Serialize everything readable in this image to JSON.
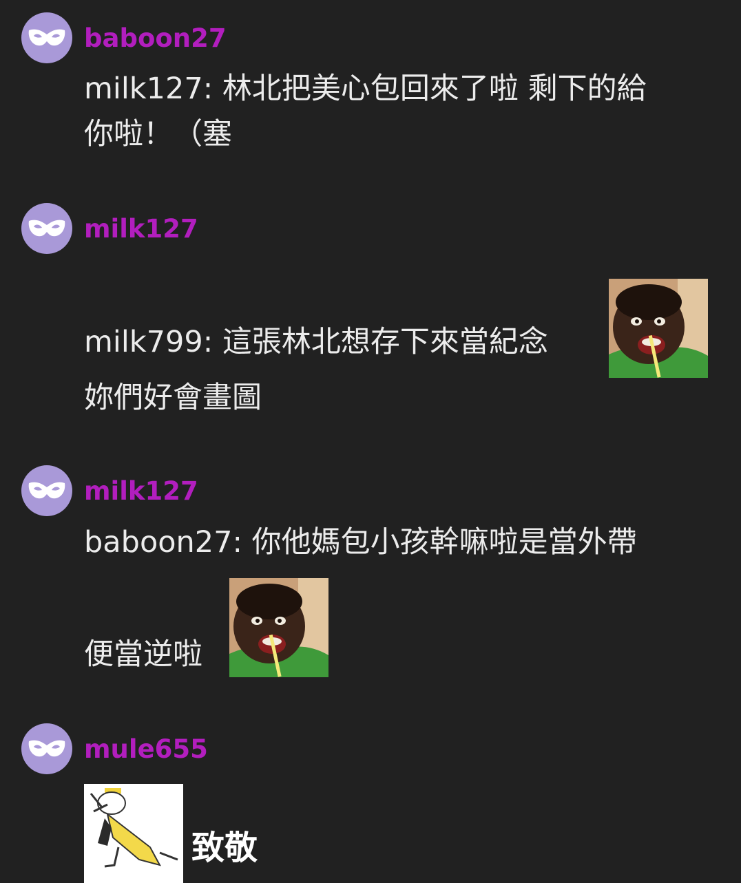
{
  "theme": {
    "background": "#212121",
    "username_color": "#b21ebe",
    "avatar_color": "#a999d8",
    "text_color": "#ececec"
  },
  "comments": [
    {
      "avatar_icon": "mask-icon",
      "username": "baboon27",
      "lines": [
        "milk127: 林北把美心包回來了啦 剩下的給",
        "你啦！（塞"
      ]
    },
    {
      "avatar_icon": "mask-icon",
      "username": "milk127",
      "lines": [
        "milk799: 這張林北想存下來當紀念",
        "妳們好會畫圖"
      ],
      "sticker": "screaming-kid-sticker"
    },
    {
      "avatar_icon": "mask-icon",
      "username": "milk127",
      "lines": [
        "baboon27: 你他媽包小孩幹嘛啦是當外帶",
        "便當逆啦"
      ],
      "sticker": "screaming-kid-sticker"
    },
    {
      "avatar_icon": "mask-icon",
      "username": "mule655",
      "sticker": "saluting-character-sticker",
      "text": "致敬"
    }
  ]
}
